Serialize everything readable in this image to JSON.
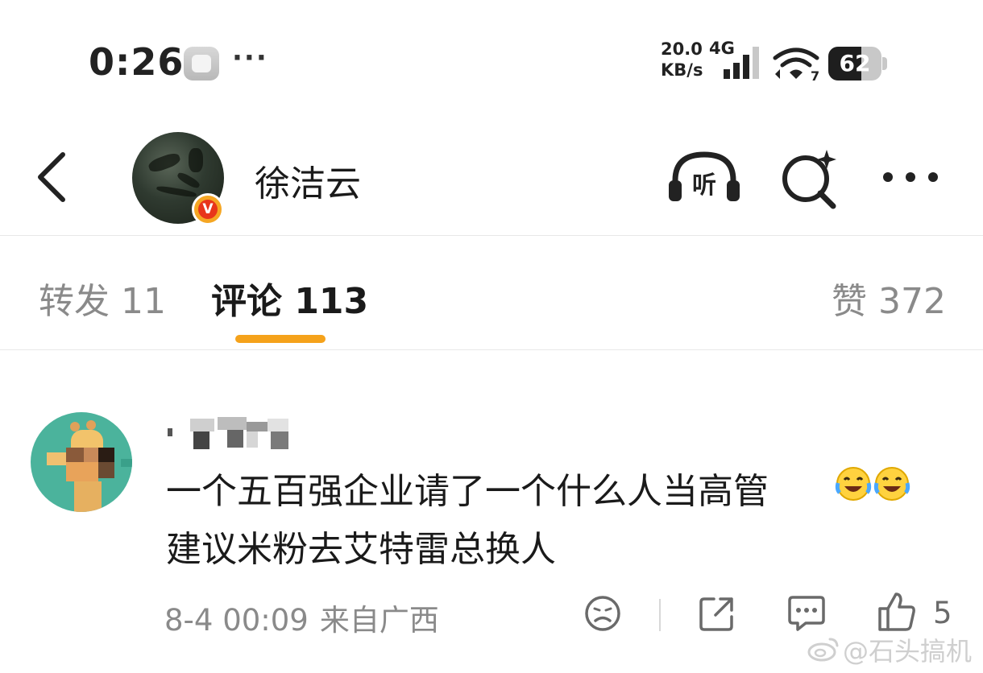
{
  "status_bar": {
    "time": "0:26",
    "net_speed_value": "20.0",
    "net_speed_unit": "KB/s",
    "network_type": "4G",
    "wifi_level": "7",
    "battery_percent": 62,
    "battery_label": "62"
  },
  "header": {
    "user_name": "徐洁云",
    "listen_label": "听"
  },
  "tabs": [
    {
      "label": "转发 11"
    },
    {
      "label": "评论 113"
    },
    {
      "label": "赞 372"
    }
  ],
  "comment": {
    "line1": "一个五百强企业请了一个什么人当高管",
    "line2": "建议米粉去艾特雷总换人",
    "time": "8-4 00:09",
    "location": "来自广西",
    "like_count": "5"
  },
  "watermark": {
    "text": "@石头搞机"
  },
  "colors": {
    "accent": "#f5a21b",
    "muted": "#8a8a8a",
    "text": "#1a1a1a"
  }
}
